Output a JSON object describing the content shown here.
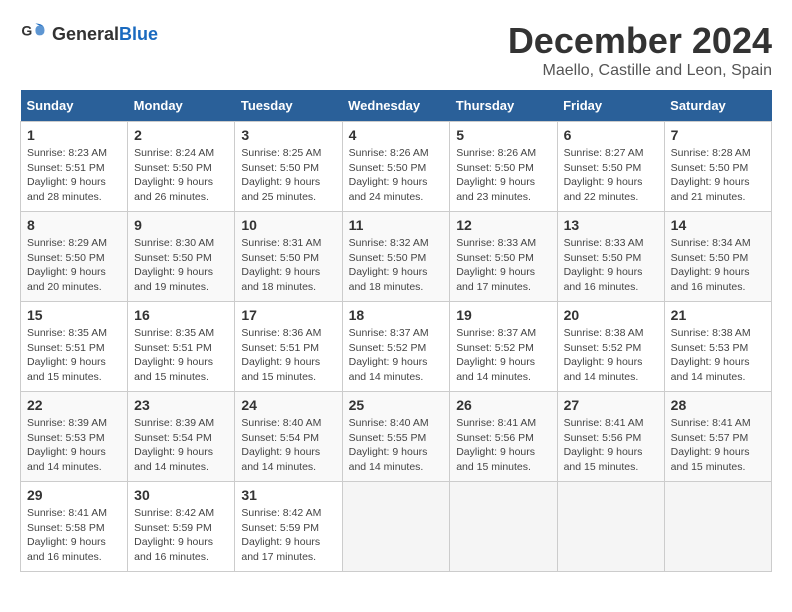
{
  "logo": {
    "text_general": "General",
    "text_blue": "Blue"
  },
  "header": {
    "month_title": "December 2024",
    "location": "Maello, Castille and Leon, Spain"
  },
  "days_of_week": [
    "Sunday",
    "Monday",
    "Tuesday",
    "Wednesday",
    "Thursday",
    "Friday",
    "Saturday"
  ],
  "weeks": [
    [
      {
        "day": "1",
        "info": "Sunrise: 8:23 AM\nSunset: 5:51 PM\nDaylight: 9 hours and 28 minutes."
      },
      {
        "day": "2",
        "info": "Sunrise: 8:24 AM\nSunset: 5:50 PM\nDaylight: 9 hours and 26 minutes."
      },
      {
        "day": "3",
        "info": "Sunrise: 8:25 AM\nSunset: 5:50 PM\nDaylight: 9 hours and 25 minutes."
      },
      {
        "day": "4",
        "info": "Sunrise: 8:26 AM\nSunset: 5:50 PM\nDaylight: 9 hours and 24 minutes."
      },
      {
        "day": "5",
        "info": "Sunrise: 8:26 AM\nSunset: 5:50 PM\nDaylight: 9 hours and 23 minutes."
      },
      {
        "day": "6",
        "info": "Sunrise: 8:27 AM\nSunset: 5:50 PM\nDaylight: 9 hours and 22 minutes."
      },
      {
        "day": "7",
        "info": "Sunrise: 8:28 AM\nSunset: 5:50 PM\nDaylight: 9 hours and 21 minutes."
      }
    ],
    [
      {
        "day": "8",
        "info": "Sunrise: 8:29 AM\nSunset: 5:50 PM\nDaylight: 9 hours and 20 minutes."
      },
      {
        "day": "9",
        "info": "Sunrise: 8:30 AM\nSunset: 5:50 PM\nDaylight: 9 hours and 19 minutes."
      },
      {
        "day": "10",
        "info": "Sunrise: 8:31 AM\nSunset: 5:50 PM\nDaylight: 9 hours and 18 minutes."
      },
      {
        "day": "11",
        "info": "Sunrise: 8:32 AM\nSunset: 5:50 PM\nDaylight: 9 hours and 18 minutes."
      },
      {
        "day": "12",
        "info": "Sunrise: 8:33 AM\nSunset: 5:50 PM\nDaylight: 9 hours and 17 minutes."
      },
      {
        "day": "13",
        "info": "Sunrise: 8:33 AM\nSunset: 5:50 PM\nDaylight: 9 hours and 16 minutes."
      },
      {
        "day": "14",
        "info": "Sunrise: 8:34 AM\nSunset: 5:50 PM\nDaylight: 9 hours and 16 minutes."
      }
    ],
    [
      {
        "day": "15",
        "info": "Sunrise: 8:35 AM\nSunset: 5:51 PM\nDaylight: 9 hours and 15 minutes."
      },
      {
        "day": "16",
        "info": "Sunrise: 8:35 AM\nSunset: 5:51 PM\nDaylight: 9 hours and 15 minutes."
      },
      {
        "day": "17",
        "info": "Sunrise: 8:36 AM\nSunset: 5:51 PM\nDaylight: 9 hours and 15 minutes."
      },
      {
        "day": "18",
        "info": "Sunrise: 8:37 AM\nSunset: 5:52 PM\nDaylight: 9 hours and 14 minutes."
      },
      {
        "day": "19",
        "info": "Sunrise: 8:37 AM\nSunset: 5:52 PM\nDaylight: 9 hours and 14 minutes."
      },
      {
        "day": "20",
        "info": "Sunrise: 8:38 AM\nSunset: 5:52 PM\nDaylight: 9 hours and 14 minutes."
      },
      {
        "day": "21",
        "info": "Sunrise: 8:38 AM\nSunset: 5:53 PM\nDaylight: 9 hours and 14 minutes."
      }
    ],
    [
      {
        "day": "22",
        "info": "Sunrise: 8:39 AM\nSunset: 5:53 PM\nDaylight: 9 hours and 14 minutes."
      },
      {
        "day": "23",
        "info": "Sunrise: 8:39 AM\nSunset: 5:54 PM\nDaylight: 9 hours and 14 minutes."
      },
      {
        "day": "24",
        "info": "Sunrise: 8:40 AM\nSunset: 5:54 PM\nDaylight: 9 hours and 14 minutes."
      },
      {
        "day": "25",
        "info": "Sunrise: 8:40 AM\nSunset: 5:55 PM\nDaylight: 9 hours and 14 minutes."
      },
      {
        "day": "26",
        "info": "Sunrise: 8:41 AM\nSunset: 5:56 PM\nDaylight: 9 hours and 15 minutes."
      },
      {
        "day": "27",
        "info": "Sunrise: 8:41 AM\nSunset: 5:56 PM\nDaylight: 9 hours and 15 minutes."
      },
      {
        "day": "28",
        "info": "Sunrise: 8:41 AM\nSunset: 5:57 PM\nDaylight: 9 hours and 15 minutes."
      }
    ],
    [
      {
        "day": "29",
        "info": "Sunrise: 8:41 AM\nSunset: 5:58 PM\nDaylight: 9 hours and 16 minutes."
      },
      {
        "day": "30",
        "info": "Sunrise: 8:42 AM\nSunset: 5:59 PM\nDaylight: 9 hours and 16 minutes."
      },
      {
        "day": "31",
        "info": "Sunrise: 8:42 AM\nSunset: 5:59 PM\nDaylight: 9 hours and 17 minutes."
      },
      {
        "day": "",
        "info": ""
      },
      {
        "day": "",
        "info": ""
      },
      {
        "day": "",
        "info": ""
      },
      {
        "day": "",
        "info": ""
      }
    ]
  ]
}
